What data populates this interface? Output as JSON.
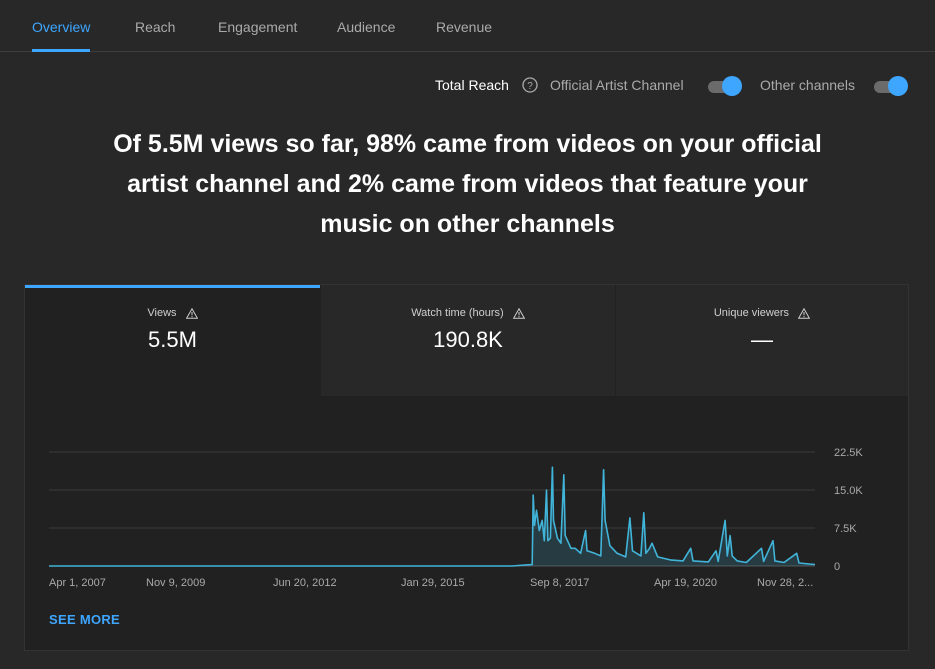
{
  "tabs": [
    {
      "label": "Overview",
      "active": true
    },
    {
      "label": "Reach"
    },
    {
      "label": "Engagement"
    },
    {
      "label": "Audience"
    },
    {
      "label": "Revenue"
    }
  ],
  "toggles": {
    "total_reach_label": "Total Reach",
    "official_label": "Official Artist Channel",
    "official_on": true,
    "other_label": "Other channels",
    "other_on": true
  },
  "headline": "Of 5.5M views so far, 98% came from videos on your official artist channel and 2% came from videos that feature your music on other channels",
  "metrics": [
    {
      "label": "Views",
      "value": "5.5M",
      "active": true
    },
    {
      "label": "Watch time (hours)",
      "value": "190.8K"
    },
    {
      "label": "Unique viewers",
      "value": "—"
    }
  ],
  "see_more": "SEE MORE",
  "colors": {
    "accent": "#3ea6ff",
    "line": "#41b4d9",
    "background": "#282828"
  },
  "chart_data": {
    "type": "area",
    "x_tick_labels": [
      "Apr 1, 2007",
      "Nov 9, 2009",
      "Jun 20, 2012",
      "Jan 29, 2015",
      "Sep 8, 2017",
      "Apr 19, 2020",
      "Nov 28, 2..."
    ],
    "y_tick_labels": [
      "0",
      "7.5K",
      "15.0K",
      "22.5K"
    ],
    "ylim": [
      0,
      22500
    ],
    "grid": true,
    "x_range": [
      "2007-04-01",
      "2022-06-01"
    ],
    "series": [
      {
        "points": [
          [
            "2007-04-01",
            0
          ],
          [
            "2016-06-01",
            0
          ],
          [
            "2016-09-01",
            200
          ],
          [
            "2016-10-25",
            300
          ],
          [
            "2016-11-01",
            14000
          ],
          [
            "2016-11-10",
            8000
          ],
          [
            "2016-11-25",
            11000
          ],
          [
            "2016-12-15",
            7000
          ],
          [
            "2017-01-05",
            9000
          ],
          [
            "2017-01-20",
            5000
          ],
          [
            "2017-02-05",
            15000
          ],
          [
            "2017-02-15",
            5000
          ],
          [
            "2017-03-05",
            5500
          ],
          [
            "2017-03-20",
            19500
          ],
          [
            "2017-03-28",
            9000
          ],
          [
            "2017-04-25",
            5500
          ],
          [
            "2017-05-20",
            4500
          ],
          [
            "2017-06-10",
            18000
          ],
          [
            "2017-06-20",
            6000
          ],
          [
            "2017-08-01",
            3500
          ],
          [
            "2017-09-01",
            3500
          ],
          [
            "2017-10-10",
            2500
          ],
          [
            "2017-11-15",
            7000
          ],
          [
            "2017-11-25",
            3000
          ],
          [
            "2018-01-20",
            2500
          ],
          [
            "2018-03-05",
            2000
          ],
          [
            "2018-03-25",
            19000
          ],
          [
            "2018-04-05",
            9000
          ],
          [
            "2018-05-10",
            4000
          ],
          [
            "2018-07-01",
            2500
          ],
          [
            "2018-09-01",
            1800
          ],
          [
            "2018-10-01",
            9500
          ],
          [
            "2018-10-20",
            3000
          ],
          [
            "2018-12-20",
            2000
          ],
          [
            "2019-01-10",
            10500
          ],
          [
            "2019-01-25",
            2500
          ],
          [
            "2019-02-20",
            3500
          ],
          [
            "2019-03-10",
            4500
          ],
          [
            "2019-04-20",
            1800
          ],
          [
            "2019-07-20",
            1200
          ],
          [
            "2019-10-20",
            1000
          ],
          [
            "2019-12-15",
            3500
          ],
          [
            "2020-01-01",
            1000
          ],
          [
            "2020-04-20",
            800
          ],
          [
            "2020-06-15",
            3000
          ],
          [
            "2020-07-01",
            900
          ],
          [
            "2020-08-20",
            9000
          ],
          [
            "2020-09-05",
            2000
          ],
          [
            "2020-09-25",
            6000
          ],
          [
            "2020-10-10",
            2000
          ],
          [
            "2020-11-15",
            1000
          ],
          [
            "2021-01-20",
            700
          ],
          [
            "2021-05-10",
            3500
          ],
          [
            "2021-05-25",
            900
          ],
          [
            "2021-08-01",
            5000
          ],
          [
            "2021-08-15",
            1000
          ],
          [
            "2021-10-20",
            700
          ],
          [
            "2022-01-20",
            2500
          ],
          [
            "2022-02-05",
            600
          ],
          [
            "2022-04-20",
            400
          ],
          [
            "2022-06-01",
            300
          ]
        ]
      }
    ]
  }
}
